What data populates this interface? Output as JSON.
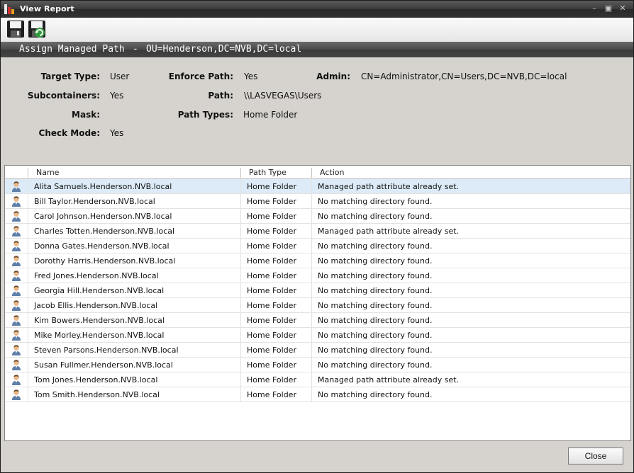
{
  "window": {
    "title": "View Report",
    "controls": [
      "minimize",
      "restore",
      "close"
    ]
  },
  "toolbar": {
    "buttons": [
      {
        "icon": "floppy-disk-icon",
        "tooltip": ""
      },
      {
        "icon": "save-refresh-icon",
        "tooltip": ""
      }
    ]
  },
  "header": {
    "action": "Assign Managed Path",
    "separator": "-",
    "target": "OU=Henderson,DC=NVB,DC=local"
  },
  "details": {
    "target_type_label": "Target Type:",
    "target_type_value": "User",
    "subcontainers_label": "Subcontainers:",
    "subcontainers_value": "Yes",
    "mask_label": "Mask:",
    "mask_value": "",
    "check_mode_label": "Check Mode:",
    "check_mode_value": "Yes",
    "enforce_path_label": "Enforce Path:",
    "enforce_path_value": "Yes",
    "path_label": "Path:",
    "path_value": "\\\\LASVEGAS\\Users",
    "path_types_label": "Path Types:",
    "path_types_value": "Home Folder",
    "admin_label": "Admin:",
    "admin_value": "CN=Administrator,CN=Users,DC=NVB,DC=local"
  },
  "grid": {
    "columns": [
      "Name",
      "Path Type",
      "Action"
    ],
    "rows": [
      {
        "name": "Alita Samuels.Henderson.NVB.local",
        "path_type": "Home Folder",
        "action": "Managed path attribute already set.",
        "selected": true
      },
      {
        "name": "Bill Taylor.Henderson.NVB.local",
        "path_type": "Home Folder",
        "action": "No matching directory found."
      },
      {
        "name": "Carol Johnson.Henderson.NVB.local",
        "path_type": "Home Folder",
        "action": "No matching directory found."
      },
      {
        "name": "Charles Totten.Henderson.NVB.local",
        "path_type": "Home Folder",
        "action": "Managed path attribute already set."
      },
      {
        "name": "Donna Gates.Henderson.NVB.local",
        "path_type": "Home Folder",
        "action": "No matching directory found."
      },
      {
        "name": "Dorothy Harris.Henderson.NVB.local",
        "path_type": "Home Folder",
        "action": "No matching directory found."
      },
      {
        "name": "Fred Jones.Henderson.NVB.local",
        "path_type": "Home Folder",
        "action": "No matching directory found."
      },
      {
        "name": "Georgia Hill.Henderson.NVB.local",
        "path_type": "Home Folder",
        "action": "No matching directory found."
      },
      {
        "name": "Jacob Ellis.Henderson.NVB.local",
        "path_type": "Home Folder",
        "action": "No matching directory found."
      },
      {
        "name": "Kim Bowers.Henderson.NVB.local",
        "path_type": "Home Folder",
        "action": "No matching directory found."
      },
      {
        "name": "Mike Morley.Henderson.NVB.local",
        "path_type": "Home Folder",
        "action": "No matching directory found."
      },
      {
        "name": "Steven Parsons.Henderson.NVB.local",
        "path_type": "Home Folder",
        "action": "No matching directory found."
      },
      {
        "name": "Susan Fullmer.Henderson.NVB.local",
        "path_type": "Home Folder",
        "action": "No matching directory found."
      },
      {
        "name": "Tom Jones.Henderson.NVB.local",
        "path_type": "Home Folder",
        "action": "Managed path attribute already set."
      },
      {
        "name": "Tom Smith.Henderson.NVB.local",
        "path_type": "Home Folder",
        "action": "No matching directory found."
      }
    ]
  },
  "footer": {
    "close_label": "Close"
  },
  "colors": {
    "titlebar": "#3a3a3a",
    "section_header": "#4a4a4a",
    "panel": "#d6d3ce",
    "selected_row": "#dcebf7"
  }
}
